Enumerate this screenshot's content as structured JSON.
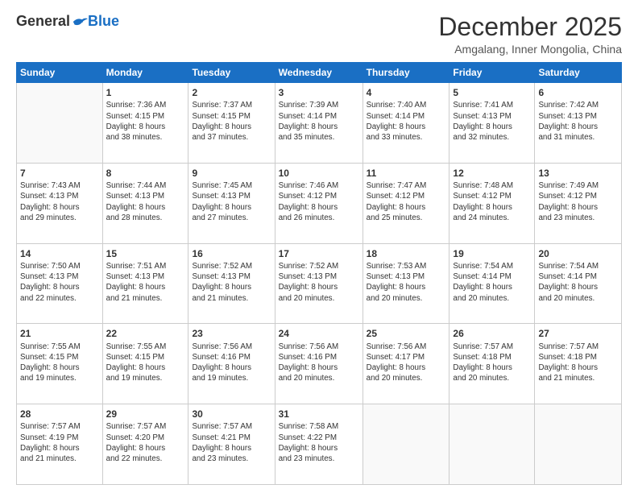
{
  "logo": {
    "general": "General",
    "blue": "Blue"
  },
  "title": "December 2025",
  "subtitle": "Amgalang, Inner Mongolia, China",
  "weekdays": [
    "Sunday",
    "Monday",
    "Tuesday",
    "Wednesday",
    "Thursday",
    "Friday",
    "Saturday"
  ],
  "weeks": [
    [
      {
        "day": "",
        "info": ""
      },
      {
        "day": "1",
        "info": "Sunrise: 7:36 AM\nSunset: 4:15 PM\nDaylight: 8 hours\nand 38 minutes."
      },
      {
        "day": "2",
        "info": "Sunrise: 7:37 AM\nSunset: 4:15 PM\nDaylight: 8 hours\nand 37 minutes."
      },
      {
        "day": "3",
        "info": "Sunrise: 7:39 AM\nSunset: 4:14 PM\nDaylight: 8 hours\nand 35 minutes."
      },
      {
        "day": "4",
        "info": "Sunrise: 7:40 AM\nSunset: 4:14 PM\nDaylight: 8 hours\nand 33 minutes."
      },
      {
        "day": "5",
        "info": "Sunrise: 7:41 AM\nSunset: 4:13 PM\nDaylight: 8 hours\nand 32 minutes."
      },
      {
        "day": "6",
        "info": "Sunrise: 7:42 AM\nSunset: 4:13 PM\nDaylight: 8 hours\nand 31 minutes."
      }
    ],
    [
      {
        "day": "7",
        "info": "Sunrise: 7:43 AM\nSunset: 4:13 PM\nDaylight: 8 hours\nand 29 minutes."
      },
      {
        "day": "8",
        "info": "Sunrise: 7:44 AM\nSunset: 4:13 PM\nDaylight: 8 hours\nand 28 minutes."
      },
      {
        "day": "9",
        "info": "Sunrise: 7:45 AM\nSunset: 4:13 PM\nDaylight: 8 hours\nand 27 minutes."
      },
      {
        "day": "10",
        "info": "Sunrise: 7:46 AM\nSunset: 4:12 PM\nDaylight: 8 hours\nand 26 minutes."
      },
      {
        "day": "11",
        "info": "Sunrise: 7:47 AM\nSunset: 4:12 PM\nDaylight: 8 hours\nand 25 minutes."
      },
      {
        "day": "12",
        "info": "Sunrise: 7:48 AM\nSunset: 4:12 PM\nDaylight: 8 hours\nand 24 minutes."
      },
      {
        "day": "13",
        "info": "Sunrise: 7:49 AM\nSunset: 4:12 PM\nDaylight: 8 hours\nand 23 minutes."
      }
    ],
    [
      {
        "day": "14",
        "info": "Sunrise: 7:50 AM\nSunset: 4:13 PM\nDaylight: 8 hours\nand 22 minutes."
      },
      {
        "day": "15",
        "info": "Sunrise: 7:51 AM\nSunset: 4:13 PM\nDaylight: 8 hours\nand 21 minutes."
      },
      {
        "day": "16",
        "info": "Sunrise: 7:52 AM\nSunset: 4:13 PM\nDaylight: 8 hours\nand 21 minutes."
      },
      {
        "day": "17",
        "info": "Sunrise: 7:52 AM\nSunset: 4:13 PM\nDaylight: 8 hours\nand 20 minutes."
      },
      {
        "day": "18",
        "info": "Sunrise: 7:53 AM\nSunset: 4:13 PM\nDaylight: 8 hours\nand 20 minutes."
      },
      {
        "day": "19",
        "info": "Sunrise: 7:54 AM\nSunset: 4:14 PM\nDaylight: 8 hours\nand 20 minutes."
      },
      {
        "day": "20",
        "info": "Sunrise: 7:54 AM\nSunset: 4:14 PM\nDaylight: 8 hours\nand 20 minutes."
      }
    ],
    [
      {
        "day": "21",
        "info": "Sunrise: 7:55 AM\nSunset: 4:15 PM\nDaylight: 8 hours\nand 19 minutes."
      },
      {
        "day": "22",
        "info": "Sunrise: 7:55 AM\nSunset: 4:15 PM\nDaylight: 8 hours\nand 19 minutes."
      },
      {
        "day": "23",
        "info": "Sunrise: 7:56 AM\nSunset: 4:16 PM\nDaylight: 8 hours\nand 19 minutes."
      },
      {
        "day": "24",
        "info": "Sunrise: 7:56 AM\nSunset: 4:16 PM\nDaylight: 8 hours\nand 20 minutes."
      },
      {
        "day": "25",
        "info": "Sunrise: 7:56 AM\nSunset: 4:17 PM\nDaylight: 8 hours\nand 20 minutes."
      },
      {
        "day": "26",
        "info": "Sunrise: 7:57 AM\nSunset: 4:18 PM\nDaylight: 8 hours\nand 20 minutes."
      },
      {
        "day": "27",
        "info": "Sunrise: 7:57 AM\nSunset: 4:18 PM\nDaylight: 8 hours\nand 21 minutes."
      }
    ],
    [
      {
        "day": "28",
        "info": "Sunrise: 7:57 AM\nSunset: 4:19 PM\nDaylight: 8 hours\nand 21 minutes."
      },
      {
        "day": "29",
        "info": "Sunrise: 7:57 AM\nSunset: 4:20 PM\nDaylight: 8 hours\nand 22 minutes."
      },
      {
        "day": "30",
        "info": "Sunrise: 7:57 AM\nSunset: 4:21 PM\nDaylight: 8 hours\nand 23 minutes."
      },
      {
        "day": "31",
        "info": "Sunrise: 7:58 AM\nSunset: 4:22 PM\nDaylight: 8 hours\nand 23 minutes."
      },
      {
        "day": "",
        "info": ""
      },
      {
        "day": "",
        "info": ""
      },
      {
        "day": "",
        "info": ""
      }
    ]
  ]
}
